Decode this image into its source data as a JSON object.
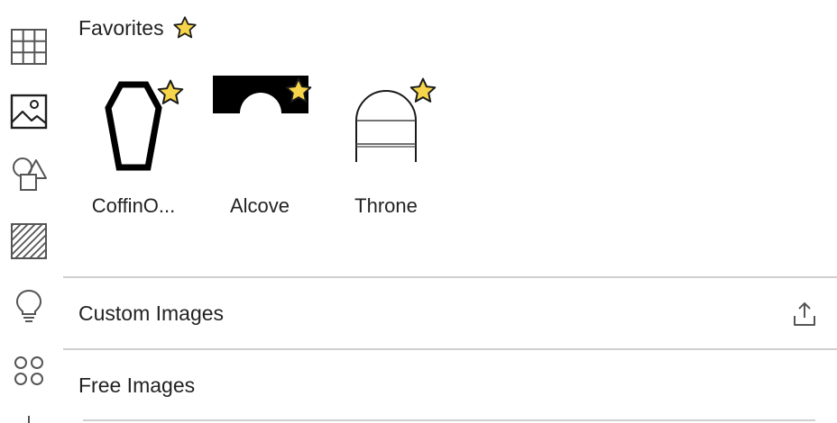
{
  "sidebar": {
    "tools": [
      {
        "icon": "grid-icon"
      },
      {
        "icon": "image-icon"
      },
      {
        "icon": "shapes-icon"
      },
      {
        "icon": "hatch-pattern-icon"
      },
      {
        "icon": "lightbulb-icon"
      },
      {
        "icon": "four-circles-icon"
      }
    ]
  },
  "favorites": {
    "title": "Favorites",
    "title_icon": "star-icon",
    "items": [
      {
        "label": "CoffinO...",
        "icon": "coffin-icon",
        "favorited": true
      },
      {
        "label": "Alcove",
        "icon": "alcove-icon",
        "favorited": true
      },
      {
        "label": "Throne",
        "icon": "throne-icon",
        "favorited": true
      }
    ]
  },
  "custom_images": {
    "title": "Custom Images",
    "action_icon": "upload-icon"
  },
  "free_images": {
    "title": "Free Images"
  },
  "colors": {
    "star_fill": "#F7D54A",
    "star_stroke": "#1a1a1a",
    "divider": "#CFCFCF",
    "icon_gray": "#555555"
  }
}
